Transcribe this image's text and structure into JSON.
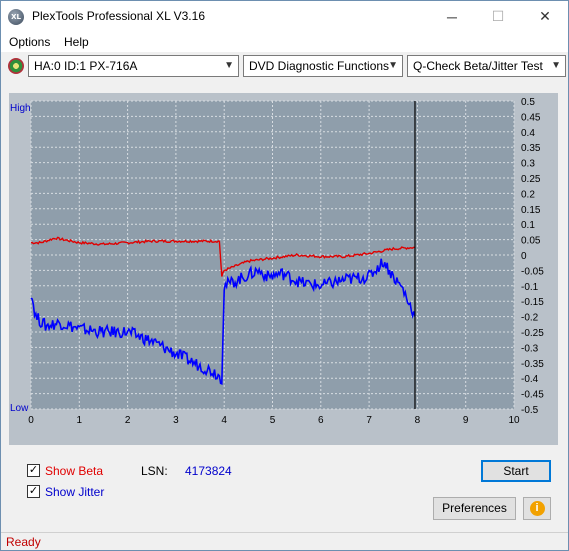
{
  "window": {
    "title": "PlexTools Professional XL V3.16",
    "app_icon_text": "XL",
    "controls": {
      "minimize": "─",
      "maximize": "☐",
      "close": "✕"
    }
  },
  "menu": {
    "options": "Options",
    "help": "Help"
  },
  "toolbar": {
    "drive": "HA:0 ID:1  PX-716A",
    "function": "DVD Diagnostic Functions",
    "test": "Q-Check Beta/Jitter Test"
  },
  "chart_labels": {
    "high": "High",
    "low": "Low"
  },
  "chart_data": {
    "type": "line",
    "x_ticks": [
      "0",
      "1",
      "2",
      "3",
      "4",
      "5",
      "6",
      "7",
      "8",
      "9",
      "10"
    ],
    "xlim": [
      0,
      10
    ],
    "y_right_ticks": [
      "0.5",
      "0.45",
      "0.4",
      "0.35",
      "0.3",
      "0.25",
      "0.2",
      "0.15",
      "0.1",
      "0.05",
      "0",
      "-0.05",
      "-0.1",
      "-0.15",
      "-0.2",
      "-0.25",
      "-0.3",
      "-0.35",
      "-0.4",
      "-0.45",
      "-0.5"
    ],
    "ylim": [
      -0.5,
      0.5
    ],
    "grid": true,
    "cursor_x": 7.95,
    "series": [
      {
        "color": "#e00000",
        "x": [
          0,
          0.2,
          0.5,
          1.0,
          1.5,
          2.0,
          2.5,
          3.0,
          3.5,
          3.9,
          3.95,
          4.0,
          4.5,
          5.0,
          5.5,
          6.0,
          6.5,
          7.0,
          7.5,
          7.95
        ],
        "y": [
          0.04,
          0.04,
          0.055,
          0.04,
          0.035,
          0.04,
          0.045,
          0.045,
          0.045,
          0.045,
          -0.07,
          -0.05,
          -0.02,
          -0.01,
          0.0,
          -0.005,
          -0.005,
          0.005,
          0.02,
          0.025
        ]
      },
      {
        "color": "#0000ff",
        "x": [
          0,
          0.1,
          0.3,
          0.6,
          1.0,
          1.5,
          2.0,
          2.5,
          3.0,
          3.5,
          3.8,
          3.95,
          4.0,
          4.3,
          4.7,
          4.9,
          5.2,
          5.6,
          6.0,
          6.5,
          7.0,
          7.3,
          7.5,
          7.7,
          7.8,
          7.9,
          7.95
        ],
        "y": [
          -0.12,
          -0.2,
          -0.23,
          -0.22,
          -0.24,
          -0.25,
          -0.25,
          -0.28,
          -0.32,
          -0.36,
          -0.38,
          -0.4,
          -0.1,
          -0.08,
          -0.05,
          -0.07,
          -0.06,
          -0.09,
          -0.1,
          -0.08,
          -0.07,
          -0.02,
          -0.07,
          -0.11,
          -0.15,
          -0.18,
          -0.2
        ]
      }
    ]
  },
  "options": {
    "show_beta": "Show Beta",
    "show_jitter": "Show Jitter",
    "lsn_label": "LSN:",
    "lsn_value": "4173824",
    "check_mark": "✓"
  },
  "buttons": {
    "start": "Start",
    "preferences": "Preferences",
    "info": "i"
  },
  "status": {
    "text": "Ready"
  },
  "colors": {
    "beta": "#e00000",
    "jitter": "#0000ff",
    "accent": "#0078d7"
  }
}
